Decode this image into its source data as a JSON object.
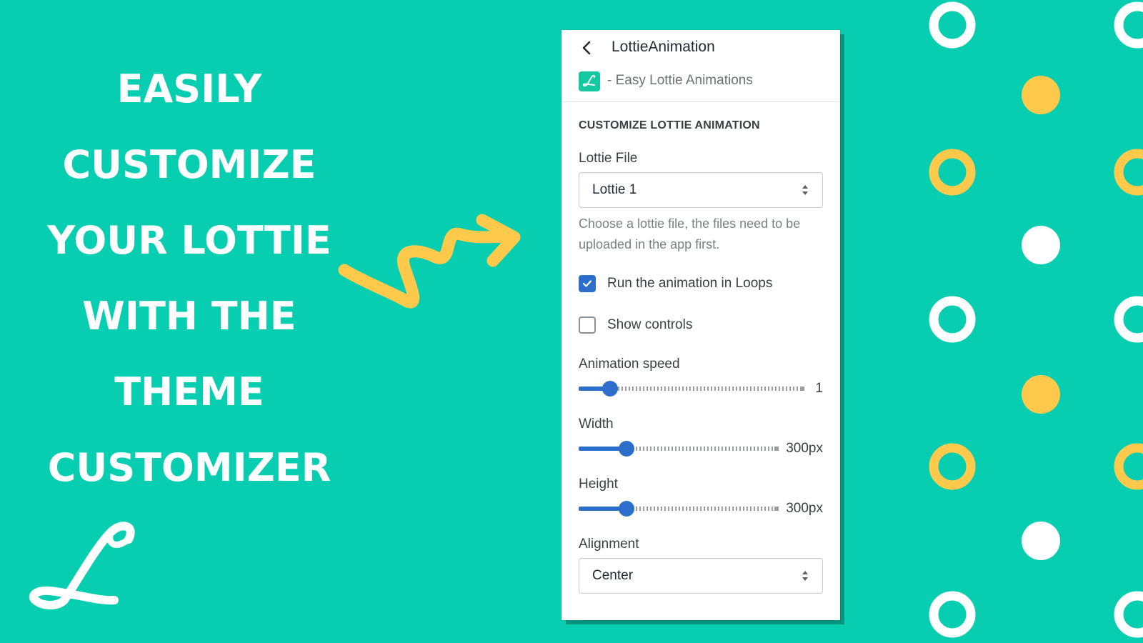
{
  "colors": {
    "background": "#08ceb1",
    "accent_yellow": "#ffca4b",
    "white": "#ffffff",
    "control_blue": "#2c6ecb"
  },
  "headline": {
    "lines": [
      "EASILY",
      "CUSTOMIZE",
      "YOUR LOTTIE",
      "WITH THE",
      "THEME",
      "CUSTOMIZER"
    ]
  },
  "logo": {
    "icon": "lottie-script-l-logo"
  },
  "arrow": {
    "icon": "squiggly-arrow-right"
  },
  "panel": {
    "back_icon": "chevron-left",
    "title": "LottieAnimation",
    "app_icon": "easy-lottie-app-icon",
    "app_name": "- Easy Lottie Animations",
    "section_title": "CUSTOMIZE LOTTIE ANIMATION",
    "lottie_file": {
      "label": "Lottie File",
      "value": "Lottie 1",
      "help": "Choose a lottie file, the files need to be uploaded in the app first."
    },
    "loop_checkbox": {
      "label": "Run the animation in Loops",
      "checked": true
    },
    "controls_checkbox": {
      "label": "Show controls",
      "checked": false
    },
    "animation_speed": {
      "label": "Animation speed",
      "value": "1",
      "fill_fraction": 0.14
    },
    "width": {
      "label": "Width",
      "value": "300px",
      "fill_fraction": 0.24
    },
    "height": {
      "label": "Height",
      "value": "300px",
      "fill_fraction": 0.24
    },
    "alignment": {
      "label": "Alignment",
      "value": "Center"
    }
  }
}
